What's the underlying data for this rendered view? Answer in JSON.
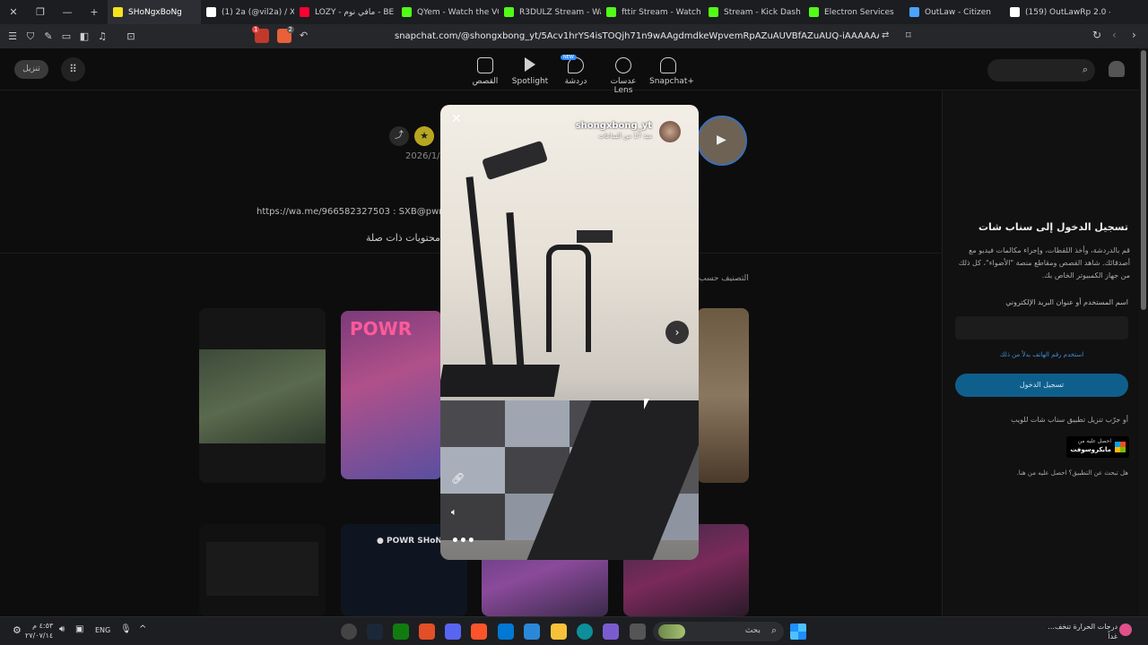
{
  "tabs": [
    {
      "label": "SHoNgxBoNg",
      "active": true,
      "color": "#f7e31b"
    },
    {
      "label": "(1) 2a (@vil2a) / X",
      "color": "#ffffff"
    },
    {
      "label": "LOZY - مافي نوم - BE",
      "color": "#ff0033"
    },
    {
      "label": "QYem - Watch the VO",
      "color": "#53fc18"
    },
    {
      "label": "R3DULZ Stream - Watc",
      "color": "#53fc18"
    },
    {
      "label": "fttir Stream - Watch Liv",
      "color": "#53fc18"
    },
    {
      "label": "Stream - Kick Dash",
      "color": "#53fc18"
    },
    {
      "label": "Electron Services",
      "color": "#53fc18"
    },
    {
      "label": "OutLaw - Citizen",
      "color": "#4aa3ff"
    },
    {
      "label": "(159) OutLawRp 2.0 - L",
      "color": "#ffffff"
    }
  ],
  "address": {
    "url": "snapchat.com/@shongxbong_yt/5Acv1hrYS4isTOQjh71n9wAAgdmdkeWpvemRpAZuAUVBfAZuAUQ-iAAAAAA",
    "shield_badge": "2",
    "alert_badge": "1"
  },
  "header": {
    "download_label": "تنزيل",
    "nav": [
      {
        "label": "القصص",
        "icon": "stories-icon"
      },
      {
        "label": "Spotlight",
        "icon": "play-icon"
      },
      {
        "label": "دردشة",
        "icon": "chat-icon",
        "badge": "NEW"
      },
      {
        "label": "عدسات Lens",
        "icon": "lens-icon"
      },
      {
        "label": "Snapchat+",
        "icon": "ghost-icon"
      }
    ]
  },
  "profile": {
    "date": "2026/1/",
    "link_text": "https://wa.me/966582327503 : SXB@pwr",
    "related_heading": "محتويات ذات صلة",
    "sort_label": "التصنيف حسب"
  },
  "modal": {
    "username": "shongxbong_yt",
    "time_ago": "منذ 17 من الساعات"
  },
  "login": {
    "title": "تسجيل الدخول إلى سناب شات",
    "desc": "قم بالدردشة، وأخذ اللقطات، وإجراء مكالمات فيديو مع أصدقائك. شاهد القصص ومقاطع منصة \"الأضواء\"، كل ذلك من جهاز الكمبيوتر الخاص بك.",
    "field_label": "اسم المستخدم أو عنوان البريد الإلكتروني",
    "phone_link": "استخدم رقم الهاتف بدلاً من ذلك",
    "login_button": "تسجيل الدخول",
    "app_text": "أو جرّب تنزيل تطبيق سناب شات للويب",
    "store_line1": "احصل عليه من",
    "store_line2": "مايكروسوفت",
    "footer_text": "هل تبحث عن التطبيق؟ احصل عليه من هنا."
  },
  "taskbar": {
    "weather_line1": "درجات الحرارة تنخف...",
    "weather_line2": "غداً",
    "search_placeholder": "بحث",
    "lang": "ENG",
    "time": "٤:٥٣ م",
    "date": "٢٧/٠٧/١٤"
  }
}
